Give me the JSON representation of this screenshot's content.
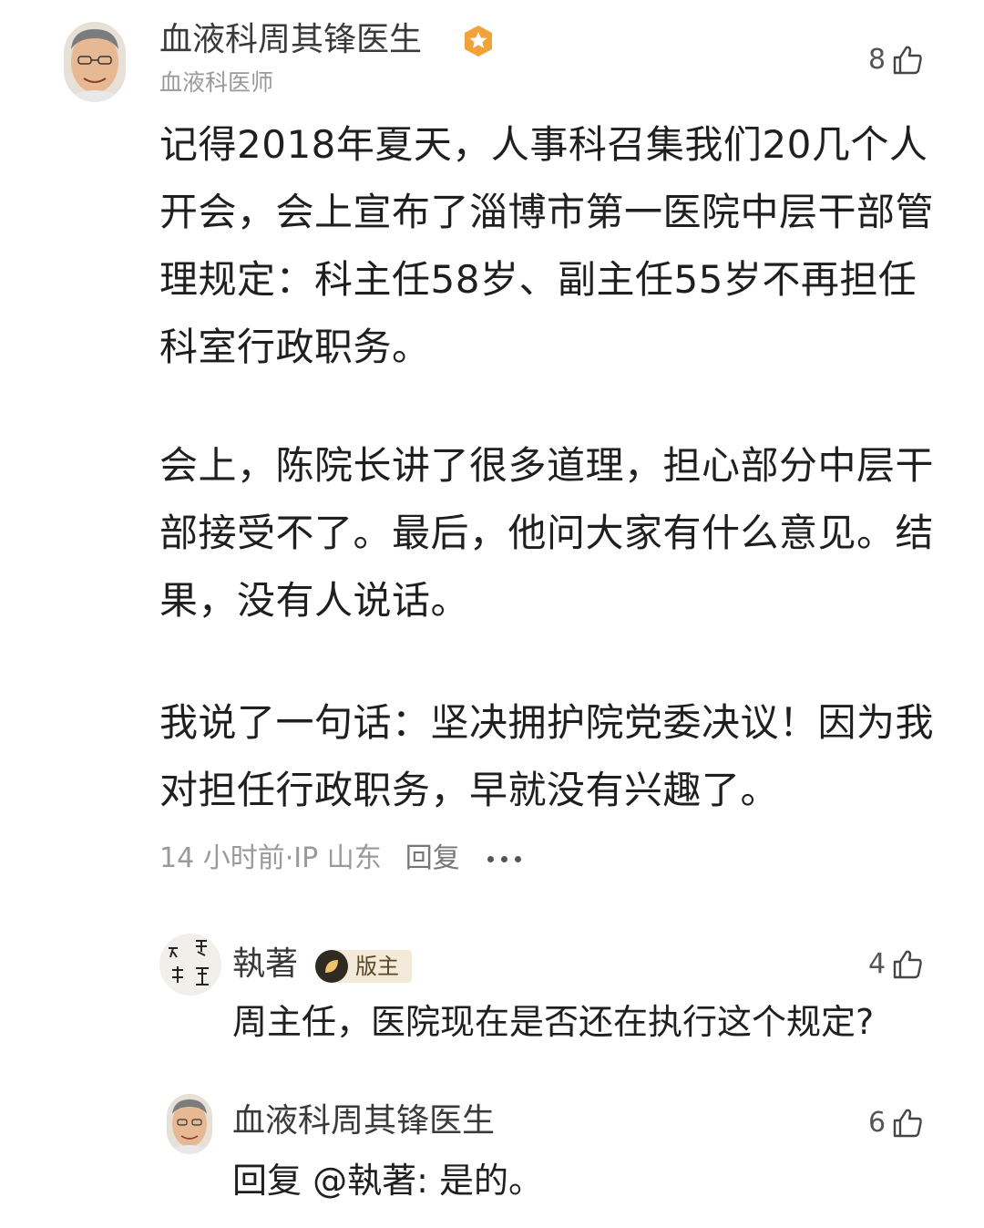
{
  "main_comment": {
    "author": "血液科周其锋医生",
    "author_title": "血液科医师",
    "likes": "8",
    "paragraphs": [
      "记得2018年夏天，人事科召集我们20几个人开会，会上宣布了淄博市第一医院中层干部管理规定：科主任58岁、副主任55岁不再担任科室行政职务。",
      "会上，陈院长讲了很多道理，担心部分中层干部接受不了。最后，他问大家有什么意见。结果，没有人说话。",
      "我说了一句话：坚决拥护院党委决议！因为我对担任行政职务，早就没有兴趣了。"
    ],
    "time": "14 小时前·IP 山东",
    "reply_label": "回复",
    "more_icon": "more-dots-icon"
  },
  "replies": [
    {
      "author": "執著",
      "badge": "版主",
      "likes": "4",
      "text": "周主任，医院现在是否还在执行这个规定?"
    },
    {
      "author": "血液科周其锋医生",
      "likes": "6",
      "text": "回复 @執著: 是的。"
    }
  ],
  "colors": {
    "verified_badge": "#f2a23a",
    "moderator_badge_bg": "#f3ead9"
  }
}
